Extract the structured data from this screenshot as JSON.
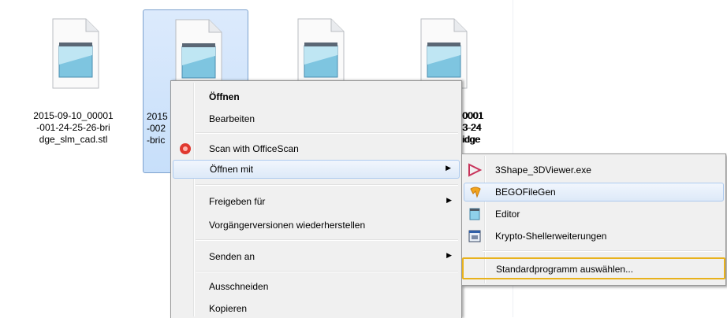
{
  "files": [
    {
      "label": "2015-09-10_00001\n-001-24-25-26-bri\ndge_slm_cad.stl",
      "icon": "notepad-document-icon"
    },
    {
      "label": "2015\n-002\n-bric",
      "icon": "notepad-document-icon"
    },
    {
      "label": "0001\n3-24\nidge",
      "icon": "notepad-document-icon"
    },
    {
      "label": "",
      "icon": "notepad-document-icon"
    }
  ],
  "context_menu": {
    "open": "Öffnen",
    "edit": "Bearbeiten",
    "scan": "Scan with OfficeScan",
    "open_with": "Öffnen mit",
    "share": "Freigeben für",
    "restore": "Vorgängerversionen wiederherstellen",
    "send_to": "Senden an",
    "cut": "Ausschneiden",
    "copy": "Kopieren"
  },
  "submenu": {
    "items": [
      {
        "label": "3Shape_3DViewer.exe",
        "icon": "3shape-viewer-icon"
      },
      {
        "label": "BEGOFileGen",
        "icon": "bego-filegen-icon"
      },
      {
        "label": "Editor",
        "icon": "notepad-editor-icon"
      },
      {
        "label": "Krypto-Shellerweiterungen",
        "icon": "crypto-shell-icon"
      }
    ],
    "choose_default": "Standardprogramm auswählen..."
  },
  "colors": {
    "selection": "#c7dffa",
    "focus_outline": "#e8b21c",
    "menu_bg": "#f0f0f0"
  }
}
